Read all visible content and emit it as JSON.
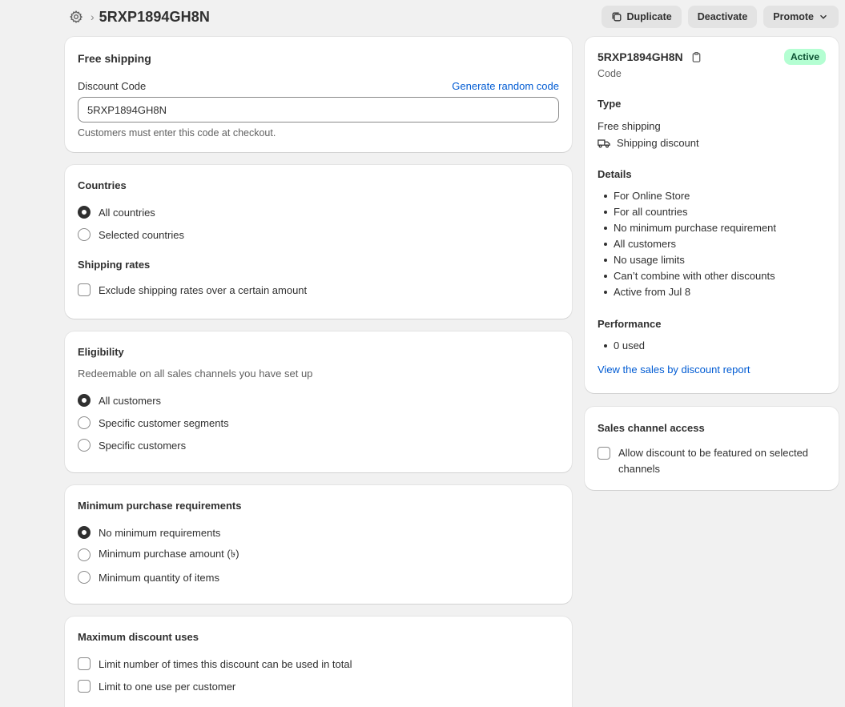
{
  "header": {
    "title": "5RXP1894GH8N",
    "duplicate_label": "Duplicate",
    "deactivate_label": "Deactivate",
    "promote_label": "Promote"
  },
  "code_card": {
    "title": "Free shipping",
    "field_label": "Discount Code",
    "generate_label": "Generate random code",
    "code_value": "5RXP1894GH8N",
    "help_text": "Customers must enter this code at checkout."
  },
  "countries_card": {
    "title": "Countries",
    "options": [
      "All countries",
      "Selected countries"
    ],
    "selected": "All countries",
    "rates_title": "Shipping rates",
    "exclude_label": "Exclude shipping rates over a certain amount"
  },
  "eligibility_card": {
    "title": "Eligibility",
    "subtitle": "Redeemable on all sales channels you have set up",
    "options": [
      "All customers",
      "Specific customer segments",
      "Specific customers"
    ],
    "selected": "All customers"
  },
  "min_card": {
    "title": "Minimum purchase requirements",
    "options": [
      "No minimum requirements",
      "Minimum purchase amount (৳)",
      "Minimum quantity of items"
    ],
    "selected": "No minimum requirements"
  },
  "max_card": {
    "title": "Maximum discount uses",
    "options": [
      "Limit number of times this discount can be used in total",
      "Limit to one use per customer"
    ]
  },
  "summary": {
    "code": "5RXP1894GH8N",
    "code_caption": "Code",
    "status": "Active",
    "type_title": "Type",
    "type_value": "Free shipping",
    "type_detail": "Shipping discount",
    "details_title": "Details",
    "details": [
      "For Online Store",
      "For all countries",
      "No minimum purchase requirement",
      "All customers",
      "No usage limits",
      "Can’t combine with other discounts",
      "Active from Jul 8"
    ],
    "performance_title": "Performance",
    "performance": [
      "0 used"
    ],
    "report_link": "View the sales by discount report"
  },
  "channel_card": {
    "title": "Sales channel access",
    "checkbox_label": "Allow discount to be featured on selected channels"
  }
}
